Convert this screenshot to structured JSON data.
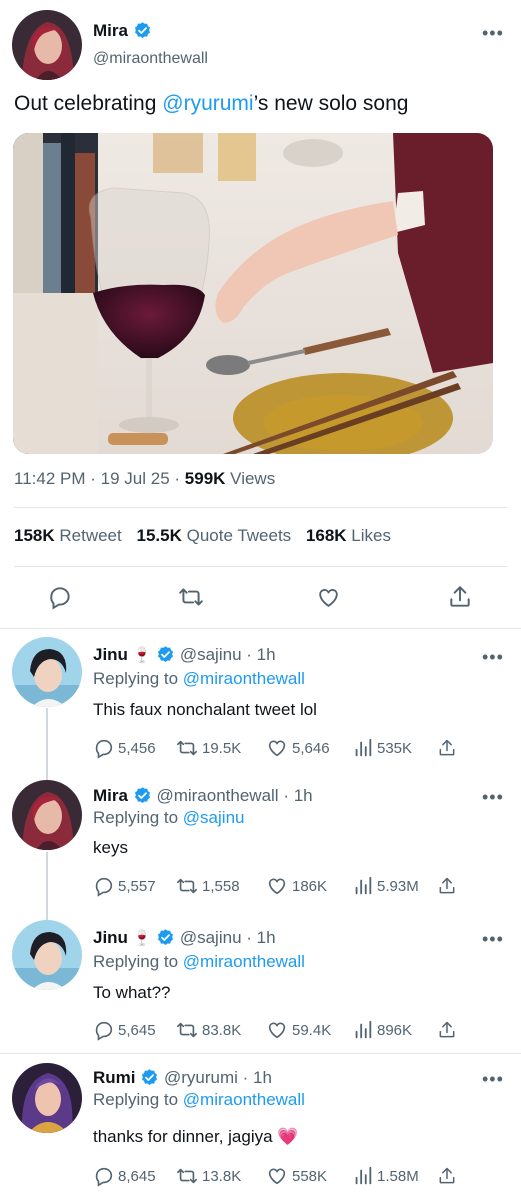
{
  "main_tweet": {
    "name": "Mira",
    "handle": "@miraonthewall",
    "text_before": "Out celebrating ",
    "mention": "@ryurumi",
    "text_after": "’s new solo song",
    "time": "11:42 PM",
    "sep1": "·",
    "date": "19 Jul 25",
    "sep2": "·",
    "views_count": "599K",
    "views_label": "Views",
    "retweets_count": "158K",
    "retweets_label": "Retweet",
    "quotes_count": "15.5K",
    "quotes_label": "Quote Tweets",
    "likes_count": "168K",
    "likes_label": "Likes"
  },
  "replies": [
    {
      "name": "Jinu",
      "emoji": "🍷",
      "handle": "@sajinu",
      "sep": "·",
      "time": "1h",
      "replying_label": "Replying to",
      "replying_to": "@miraonthewall",
      "text": "This faux nonchalant tweet lol",
      "replies": "5,456",
      "retweets": "19.5K",
      "likes": "5,646",
      "views": "535K"
    },
    {
      "name": "Mira",
      "emoji": "",
      "handle": "@miraonthewall",
      "sep": "·",
      "time": "1h",
      "replying_label": "Replying to",
      "replying_to": "@sajinu",
      "text": "keys",
      "replies": "5,557",
      "retweets": "1,558",
      "likes": "186K",
      "views": "5.93M"
    },
    {
      "name": "Jinu",
      "emoji": "🍷",
      "handle": "@sajinu",
      "sep": "·",
      "time": "1h",
      "replying_label": "Replying to",
      "replying_to": "@miraonthewall",
      "text": "To what??",
      "replies": "5,645",
      "retweets": "83.8K",
      "likes": "59.4K",
      "views": "896K"
    },
    {
      "name": "Rumi",
      "emoji": "",
      "handle": "@ryurumi",
      "sep": "·",
      "time": "1h",
      "replying_label": "Replying to",
      "replying_to": "@miraonthewall",
      "text": "thanks for dinner, jagiya 💗",
      "replies": "8,645",
      "retweets": "13.8K",
      "likes": "558K",
      "views": "1.58M"
    }
  ],
  "colors": {
    "accent": "#1d9bf0",
    "text": "#0f1419",
    "muted": "#536471",
    "divider": "#e3e6e9"
  },
  "icons": [
    "verified-badge-icon",
    "more-icon",
    "reply-icon",
    "retweet-icon",
    "like-icon",
    "share-icon",
    "views-icon"
  ]
}
